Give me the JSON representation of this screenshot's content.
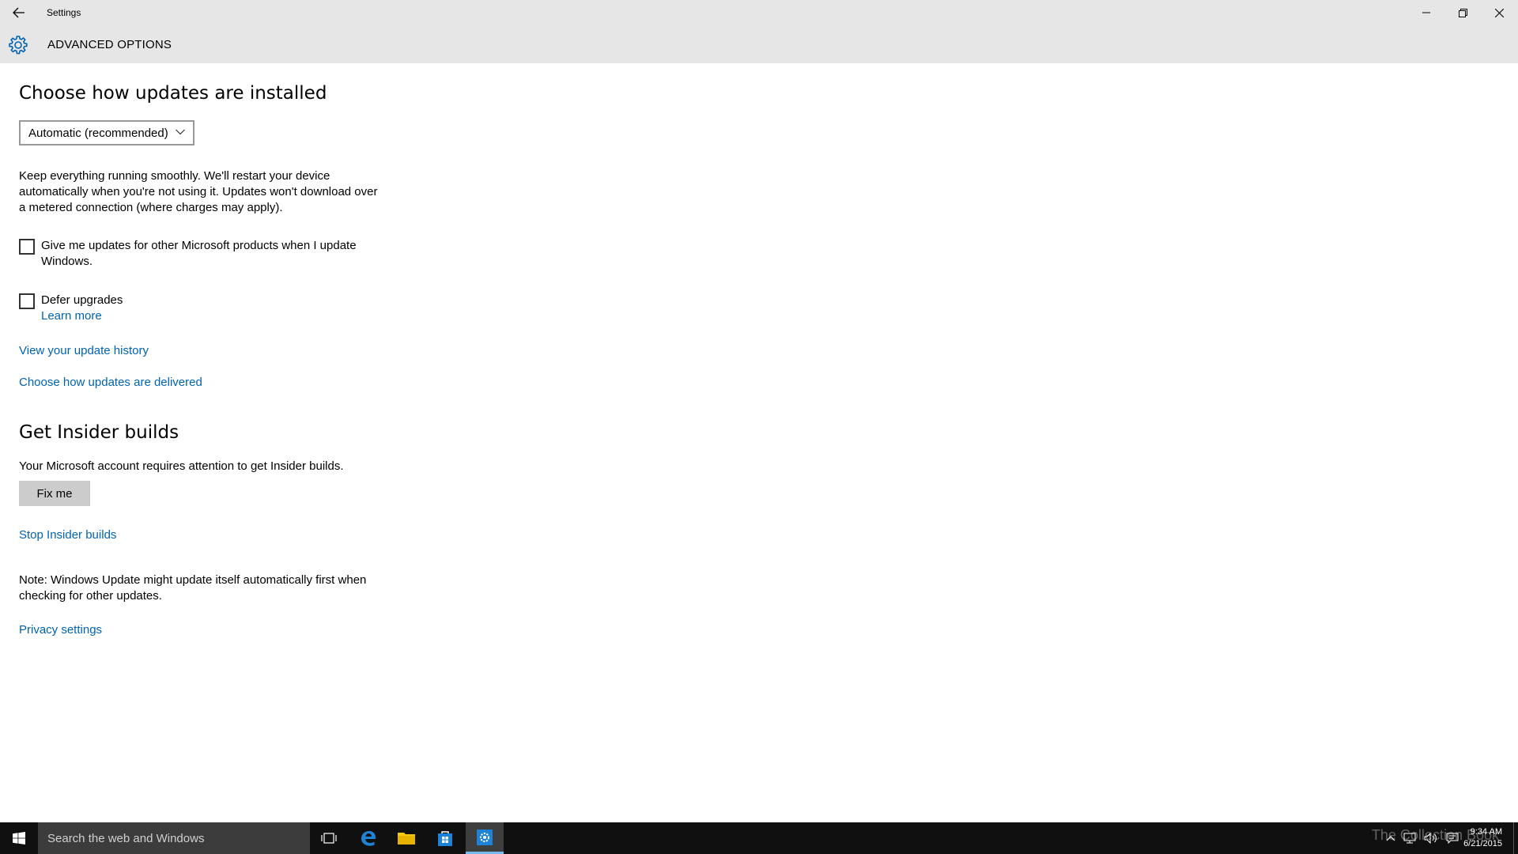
{
  "window": {
    "title": "Settings",
    "header_title": "ADVANCED OPTIONS"
  },
  "updates": {
    "heading": "Choose how updates are installed",
    "dropdown_value": "Automatic (recommended)",
    "description": "Keep everything running smoothly. We'll restart your device automatically when you're not using it. Updates won't download over a metered connection (where charges may apply).",
    "checkbox_ms_products": {
      "label_line1": "Give me updates for other Microsoft products when I update",
      "label_line2": "Windows.",
      "checked": false
    },
    "checkbox_defer": {
      "label": "Defer upgrades",
      "checked": false
    },
    "learn_more": "Learn more",
    "view_history": "View your update history",
    "choose_delivery": "Choose how updates are delivered"
  },
  "insider": {
    "heading": "Get Insider builds",
    "message": "Your Microsoft account requires attention to get Insider builds.",
    "fix_button": "Fix me",
    "stop_link": "Stop Insider builds"
  },
  "note": {
    "line1": "Note: Windows Update might update itself automatically first when",
    "line2": "checking for other updates."
  },
  "privacy_link": "Privacy settings",
  "taskbar": {
    "search_placeholder": "Search the web and Windows",
    "time": "9:34 AM",
    "date": "6/21/2015",
    "watermark": "The Collection Book"
  },
  "colors": {
    "accent": "#0063b1",
    "titlebar": "#e6e6e6",
    "taskbar": "#101010"
  }
}
